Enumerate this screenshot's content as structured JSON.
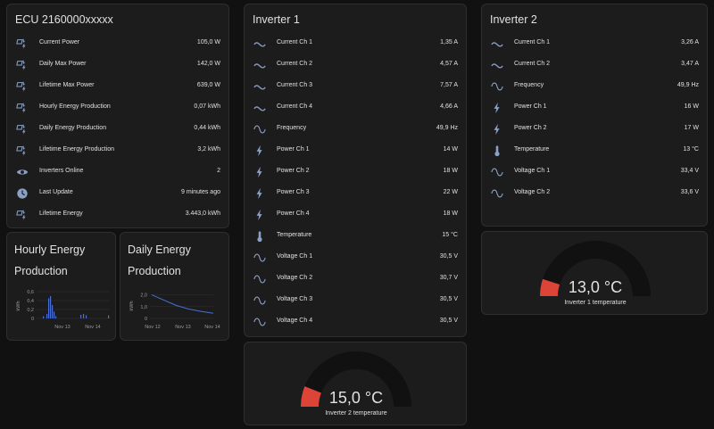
{
  "ecu": {
    "title": "ECU 2160000xxxxx",
    "rows": [
      {
        "icon": "solar-power-icon",
        "label": "Current Power",
        "value": "105,0 W"
      },
      {
        "icon": "solar-power-icon",
        "label": "Daily Max Power",
        "value": "142,0 W"
      },
      {
        "icon": "solar-power-icon",
        "label": "Lifetime Max Power",
        "value": "639,0 W"
      },
      {
        "icon": "solar-power-icon",
        "label": "Hourly Energy Production",
        "value": "0,07 kWh"
      },
      {
        "icon": "solar-power-icon",
        "label": "Daily Energy Production",
        "value": "0,44 kWh"
      },
      {
        "icon": "solar-power-icon",
        "label": "Lifetime Energy Production",
        "value": "3,2 kWh"
      },
      {
        "icon": "eye-icon",
        "label": "Inverters Online",
        "value": "2"
      },
      {
        "icon": "clock-icon",
        "label": "Last Update",
        "value": "9 minutes ago"
      },
      {
        "icon": "solar-power-icon",
        "label": "Lifetime Energy",
        "value": "3.443,0 kWh"
      }
    ]
  },
  "inverter1": {
    "title": "Inverter 1",
    "rows": [
      {
        "icon": "current-ac-icon",
        "label": "Current Ch 1",
        "value": "1,35 A"
      },
      {
        "icon": "current-ac-icon",
        "label": "Current Ch 2",
        "value": "4,57 A"
      },
      {
        "icon": "current-ac-icon",
        "label": "Current Ch 3",
        "value": "7,57 A"
      },
      {
        "icon": "current-ac-icon",
        "label": "Current Ch 4",
        "value": "4,66 A"
      },
      {
        "icon": "sine-wave-icon",
        "label": "Frequency",
        "value": "49,9 Hz"
      },
      {
        "icon": "flash-icon",
        "label": "Power Ch 1",
        "value": "14 W"
      },
      {
        "icon": "flash-icon",
        "label": "Power Ch 2",
        "value": "18 W"
      },
      {
        "icon": "flash-icon",
        "label": "Power Ch 3",
        "value": "22 W"
      },
      {
        "icon": "flash-icon",
        "label": "Power Ch 4",
        "value": "18 W"
      },
      {
        "icon": "thermometer-icon",
        "label": "Temperature",
        "value": "15 °C"
      },
      {
        "icon": "sine-wave-icon",
        "label": "Voltage Ch 1",
        "value": "30,5 V"
      },
      {
        "icon": "sine-wave-icon",
        "label": "Voltage Ch 2",
        "value": "30,7 V"
      },
      {
        "icon": "sine-wave-icon",
        "label": "Voltage Ch 3",
        "value": "30,5 V"
      },
      {
        "icon": "sine-wave-icon",
        "label": "Voltage Ch 4",
        "value": "30,5 V"
      }
    ]
  },
  "inverter2": {
    "title": "Inverter 2",
    "rows": [
      {
        "icon": "current-ac-icon",
        "label": "Current Ch 1",
        "value": "3,26 A"
      },
      {
        "icon": "current-ac-icon",
        "label": "Current Ch 2",
        "value": "3,47 A"
      },
      {
        "icon": "sine-wave-icon",
        "label": "Frequency",
        "value": "49,9 Hz"
      },
      {
        "icon": "flash-icon",
        "label": "Power Ch 1",
        "value": "16 W"
      },
      {
        "icon": "flash-icon",
        "label": "Power Ch 2",
        "value": "17 W"
      },
      {
        "icon": "thermometer-icon",
        "label": "Temperature",
        "value": "13 °C"
      },
      {
        "icon": "sine-wave-icon",
        "label": "Voltage Ch 1",
        "value": "33,4 V"
      },
      {
        "icon": "sine-wave-icon",
        "label": "Voltage Ch 2",
        "value": "33,6 V"
      }
    ]
  },
  "hourly": {
    "title_line1": "Hourly Energy",
    "title_line2": "Production",
    "unit": "kWh",
    "y_ticks": [
      "0,6",
      "0,4",
      "0,2",
      "0"
    ],
    "x_ticks": [
      "Nov 13",
      "Nov 14"
    ]
  },
  "daily": {
    "title_line1": "Daily Energy",
    "title_line2": "Production",
    "unit": "kWh",
    "y_ticks": [
      "2,0",
      "1,0",
      "0"
    ],
    "x_ticks": [
      "Nov 12",
      "Nov 13",
      "Nov 14"
    ]
  },
  "gauge1": {
    "value": "13,0 °C",
    "name": "Inverter 1 temperature",
    "fraction": 0.1
  },
  "gauge2": {
    "value": "15,0 °C",
    "name": "Inverter 2 temperature",
    "fraction": 0.12
  },
  "chart_data": [
    {
      "type": "bar",
      "x": [
        "Nov 12 23:00",
        "Nov 13 08:00",
        "Nov 13 09:00",
        "Nov 13 10:00",
        "Nov 13 11:00",
        "Nov 13 12:00",
        "Nov 13 13:00",
        "Nov 14 08:00",
        "Nov 14 09:00",
        "Nov 14 10:00",
        "Nov 14 23:00"
      ],
      "values": [
        0.05,
        0.1,
        0.45,
        0.5,
        0.3,
        0.15,
        0.05,
        0.08,
        0.1,
        0.07,
        0.07
      ],
      "ylabel": "kWh",
      "ylim": [
        0,
        0.6
      ],
      "colors": {
        "bar": "#4a6fd3",
        "grid": "#333333"
      }
    },
    {
      "type": "line",
      "x": [
        "Nov 12",
        "Nov 12 12:00",
        "Nov 13",
        "Nov 13 12:00",
        "Nov 14",
        "Nov 14 12:00"
      ],
      "values": [
        2.0,
        1.55,
        1.1,
        0.8,
        0.6,
        0.44
      ],
      "ylabel": "kWh",
      "ylim": [
        0,
        2.2
      ],
      "colors": {
        "line": "#4a6fd3",
        "grid": "#333333"
      }
    }
  ],
  "colors": {
    "icon": "#8aa0c4",
    "gauge_fill": "#db4437",
    "gauge_track": "#111111"
  }
}
